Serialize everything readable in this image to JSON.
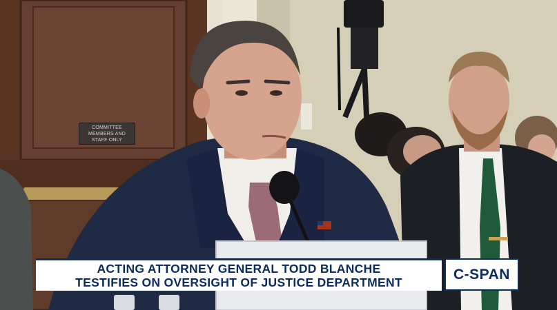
{
  "wall_sign": {
    "line1": "COMMITTEE",
    "line2": "MEMBERS AND",
    "line3": "STAFF ONLY"
  },
  "chyron": {
    "line1": "ACTING ATTORNEY GENERAL TODD BLANCHE",
    "line2": "TESTIFIES ON OVERSIGHT OF JUSTICE DEPARTMENT"
  },
  "network_logo": "C-SPAN",
  "colors": {
    "chyron_text": "#0d2b5c",
    "chyron_bg": "#ffffff",
    "wood_paneling": "#5a3524",
    "wall": "#d6cfb8",
    "suit": "#1f2a45",
    "tie_pink": "#9c6b78",
    "tie_green": "#1f5a3a"
  }
}
